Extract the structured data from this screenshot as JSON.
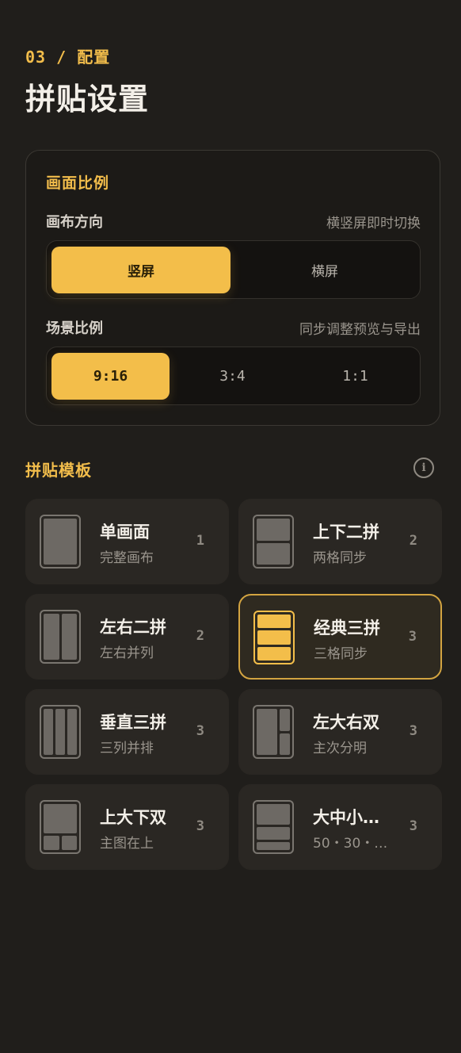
{
  "header": {
    "step": "03 / 配置",
    "title": "拼贴设置"
  },
  "ratio_card": {
    "title": "画面比例",
    "orientation": {
      "label": "画布方向",
      "hint": "横竖屏即时切换",
      "options": [
        "竖屏",
        "横屏"
      ],
      "selected": "竖屏"
    },
    "scene_ratio": {
      "label": "场景比例",
      "hint": "同步调整预览与导出",
      "options": [
        "9:16",
        "3:4",
        "1:1"
      ],
      "selected": "9:16"
    }
  },
  "templates": {
    "title": "拼贴模板",
    "info_icon": "info-icon",
    "items": [
      {
        "name": "单画面",
        "sub": "完整画布",
        "count": "1",
        "selected": false
      },
      {
        "name": "上下二拼",
        "sub": "两格同步",
        "count": "2",
        "selected": false
      },
      {
        "name": "左右二拼",
        "sub": "左右并列",
        "count": "2",
        "selected": false
      },
      {
        "name": "经典三拼",
        "sub": "三格同步",
        "count": "3",
        "selected": true
      },
      {
        "name": "垂直三拼",
        "sub": "三列并排",
        "count": "3",
        "selected": false
      },
      {
        "name": "左大右双",
        "sub": "主次分明",
        "count": "3",
        "selected": false
      },
      {
        "name": "上大下双",
        "sub": "主图在上",
        "count": "3",
        "selected": false
      },
      {
        "name": "大中小…",
        "sub": "50・30・…",
        "count": "3",
        "selected": false
      }
    ]
  },
  "colors": {
    "background": "#201e1b",
    "accent": "#f3be4a",
    "card": "#2a2723"
  }
}
